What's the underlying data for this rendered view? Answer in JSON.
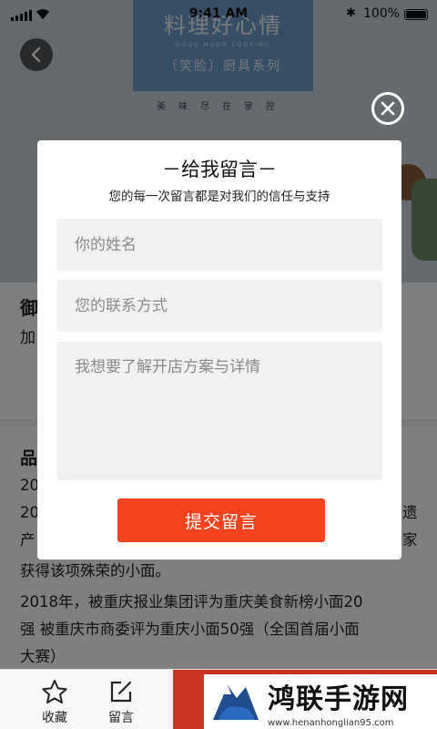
{
  "status_bar": {
    "time": "9:41 AM",
    "battery": "100%"
  },
  "hero": {
    "title": "料理好心情",
    "subtitle": "GOOD MOOD COOKING",
    "brand": "〔笑脸〕厨具系列",
    "tagline": "美味尽在掌控"
  },
  "page": {
    "section_title": "御",
    "section_sub": "加",
    "intro_title": "品",
    "lines": [
      {
        "text": "20"
      },
      {
        "text": "20"
      },
      {
        "text": "产"
      },
      {
        "text": "获得该项殊荣的小面。"
      },
      {
        "text": "2018年，被重庆报业集团评为重庆美食新榜小面20"
      },
      {
        "text": "强 被重庆市商委评为重庆小面50强（全国首届小面"
      },
      {
        "text": "大赛）"
      }
    ],
    "edge_chars": {
      "right_1": "遗",
      "right_2": "家"
    }
  },
  "bottom_bar": {
    "tabs": [
      {
        "label": "收藏",
        "icon": "star-icon"
      },
      {
        "label": "留言",
        "icon": "edit-icon"
      }
    ]
  },
  "watermark": {
    "title": "鸿联手游网",
    "url": "www.henanhonglian95.com"
  },
  "modal": {
    "title": "－给我留言－",
    "subtitle": "您的每一次留言都是对我们的信任与支持",
    "name_placeholder": "你的姓名",
    "contact_placeholder": "您的联系方式",
    "message_placeholder": "我想要了解开店方案与详情",
    "submit_label": "提交留言"
  },
  "colors": {
    "accent": "#f4431e",
    "cta_bar": "#c8341f",
    "hero_banner": "#6e9cc8",
    "overlay": "rgba(0,0,0,0.5)"
  }
}
